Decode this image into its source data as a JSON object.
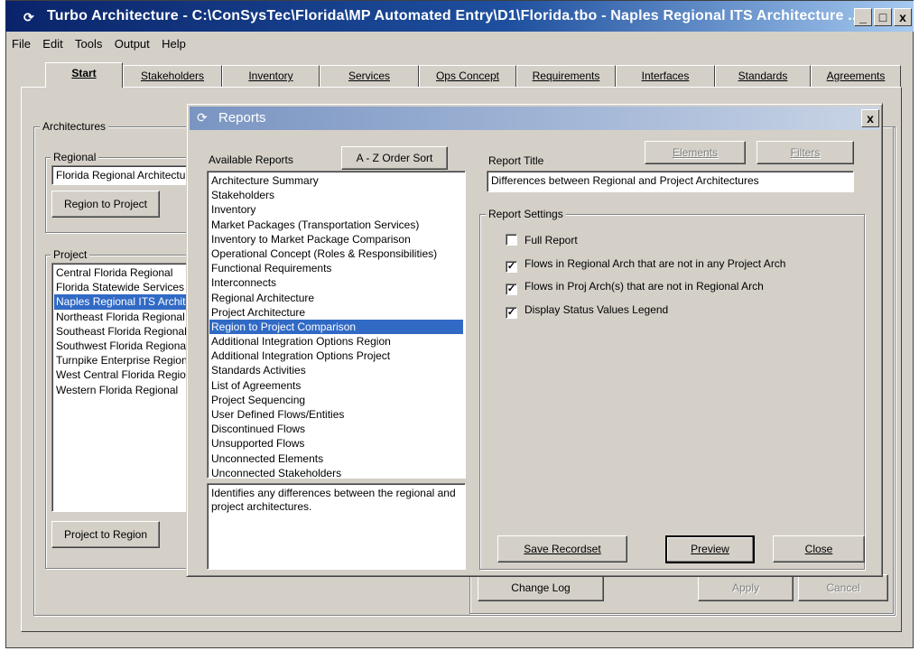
{
  "window": {
    "title": "Turbo Architecture - C:\\ConSysTec\\Florida\\MP Automated Entry\\D1\\Florida.tbo - Naples Regional ITS Architecture ...",
    "minimize": "_",
    "maximize": "□",
    "close": "x"
  },
  "menu": [
    "File",
    "Edit",
    "Tools",
    "Output",
    "Help"
  ],
  "tabs": [
    {
      "label": "Start",
      "active": true
    },
    {
      "label": "Stakeholders"
    },
    {
      "label": "Inventory"
    },
    {
      "label": "Services"
    },
    {
      "label": "Ops Concept"
    },
    {
      "label": "Requirements"
    },
    {
      "label": "Interfaces"
    },
    {
      "label": "Standards"
    },
    {
      "label": "Agreements"
    }
  ],
  "start": {
    "architectures_label": "Architectures",
    "regional_label": "Regional",
    "regional_value": "Florida Regional Architecture",
    "region_to_project_button": "Region to Project",
    "project_label": "Project",
    "projects": [
      "Central Florida Regional",
      "Florida Statewide Services",
      "Naples Regional ITS Architecture",
      "Northeast Florida Regional",
      "Southeast Florida Regional",
      "Southwest Florida Regional",
      "Turnpike Enterprise Regional",
      "West Central Florida Regional",
      "Western Florida Regional"
    ],
    "selected_project_index": 2,
    "project_to_region_button": "Project to Region",
    "change_log_button": "Change Log",
    "apply_button": "Apply",
    "cancel_button": "Cancel"
  },
  "dialog": {
    "title": "Reports",
    "close": "x",
    "available_reports_label": "Available Reports",
    "sort_button": "A - Z Order Sort",
    "reports": [
      "Architecture Summary",
      "Stakeholders",
      "Inventory",
      "Market Packages (Transportation Services)",
      "Inventory to Market Package Comparison",
      "Operational Concept (Roles & Responsibilities)",
      "Functional Requirements",
      "Interconnects",
      "Regional Architecture",
      "Project Architecture",
      "Region to Project Comparison",
      "Additional Integration Options Region",
      "Additional Integration Options Project",
      "Standards Activities",
      "List of Agreements",
      "Project Sequencing",
      "User Defined Flows/Entities",
      "Discontinued Flows",
      "Unsupported Flows",
      "Unconnected Elements",
      "Unconnected Stakeholders"
    ],
    "selected_report_index": 10,
    "description": "Identifies any differences between the regional and project architectures.",
    "elements_button": "Elements",
    "filters_button": "Filters",
    "report_title_label": "Report Title",
    "report_title_value": "Differences between Regional and Project Architectures",
    "report_settings_label": "Report Settings",
    "settings": [
      {
        "label": "Full Report",
        "checked": false
      },
      {
        "label": "Flows in Regional Arch that are not in any Project Arch",
        "checked": true
      },
      {
        "label": "Flows in Proj Arch(s) that are not in Regional Arch",
        "checked": true
      },
      {
        "label": "Display Status Values Legend",
        "checked": true
      }
    ],
    "save_recordset_button": "Save Recordset",
    "preview_button": "Preview",
    "close_button": "Close"
  }
}
